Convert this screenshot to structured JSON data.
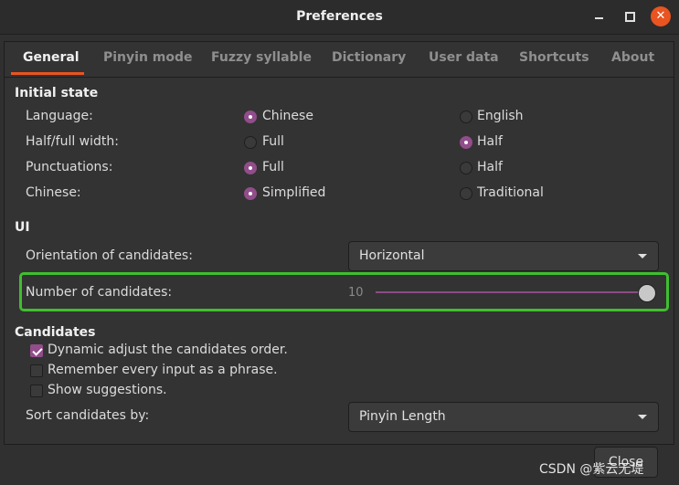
{
  "window": {
    "title": "Preferences",
    "controls": {
      "minimize": "minimize",
      "maximize": "maximize",
      "close": "close"
    }
  },
  "tabs": [
    {
      "label": "General",
      "active": true
    },
    {
      "label": "Pinyin mode"
    },
    {
      "label": "Fuzzy syllable"
    },
    {
      "label": "Dictionary"
    },
    {
      "label": "User data"
    },
    {
      "label": "Shortcuts"
    },
    {
      "label": "About"
    }
  ],
  "initial_state": {
    "heading": "Initial state",
    "rows": [
      {
        "label": "Language:",
        "option_a": "Chinese",
        "option_b": "English",
        "selected": "a"
      },
      {
        "label": "Half/full width:",
        "option_a": "Full",
        "option_b": "Half",
        "selected": "b"
      },
      {
        "label": "Punctuations:",
        "option_a": "Full",
        "option_b": "Half",
        "selected": "a"
      },
      {
        "label": "Chinese:",
        "option_a": "Simplified",
        "option_b": "Traditional",
        "selected": "a"
      }
    ]
  },
  "ui": {
    "heading": "UI",
    "orientation_label": "Orientation of candidates:",
    "orientation_value": "Horizontal",
    "num_candidates_label": "Number of candidates:",
    "num_candidates_value": "10",
    "num_candidates_fraction": 1.0
  },
  "candidates": {
    "heading": "Candidates",
    "options": [
      {
        "label": "Dynamic adjust the candidates order.",
        "checked": true
      },
      {
        "label": "Remember every input as a phrase.",
        "checked": false
      },
      {
        "label": "Show suggestions.",
        "checked": false
      }
    ],
    "sort_label": "Sort candidates by:",
    "sort_value": "Pinyin Length"
  },
  "footer": {
    "close_label": "Close"
  },
  "watermark": "CSDN @紫云无堤",
  "colors": {
    "accent": "#e95420",
    "selection": "#924d8b",
    "highlight_box": "#3fbf2e"
  },
  "icons": {
    "dropdown": "chevron-down-icon",
    "check": "check-icon"
  }
}
